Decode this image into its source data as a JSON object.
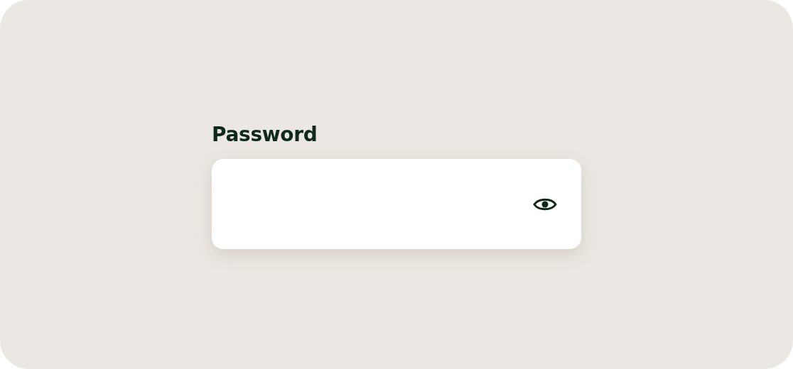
{
  "password_field": {
    "label": "Password"
  }
}
